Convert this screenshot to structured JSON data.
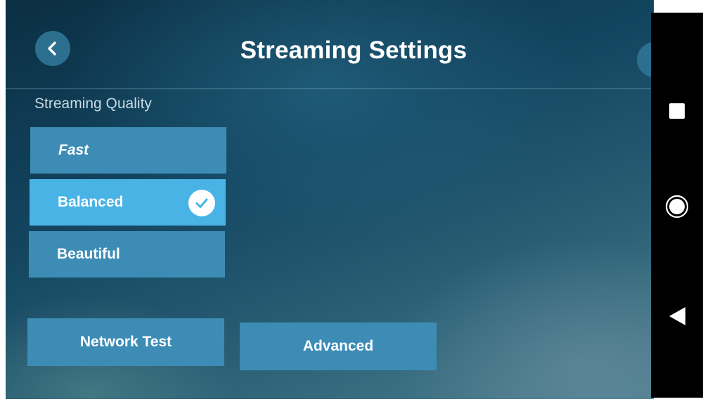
{
  "header": {
    "title": "Streaming Settings",
    "back_icon": "chevron-left-icon"
  },
  "quality": {
    "label": "Streaming Quality",
    "options": [
      {
        "label": "Fast",
        "selected": false
      },
      {
        "label": "Balanced",
        "selected": true
      },
      {
        "label": "Beautiful",
        "selected": false
      }
    ],
    "selected_icon": "checkmark-icon"
  },
  "actions": {
    "network_test": "Network Test",
    "advanced": "Advanced"
  },
  "navbar": {
    "recent_icon": "square-icon",
    "home_icon": "circle-icon",
    "back_icon": "triangle-back-icon"
  },
  "colors": {
    "option_bg": "#3d8cb6",
    "option_selected_bg": "#49b3e6",
    "text": "#ffffff",
    "navbar_bg": "#000000"
  }
}
